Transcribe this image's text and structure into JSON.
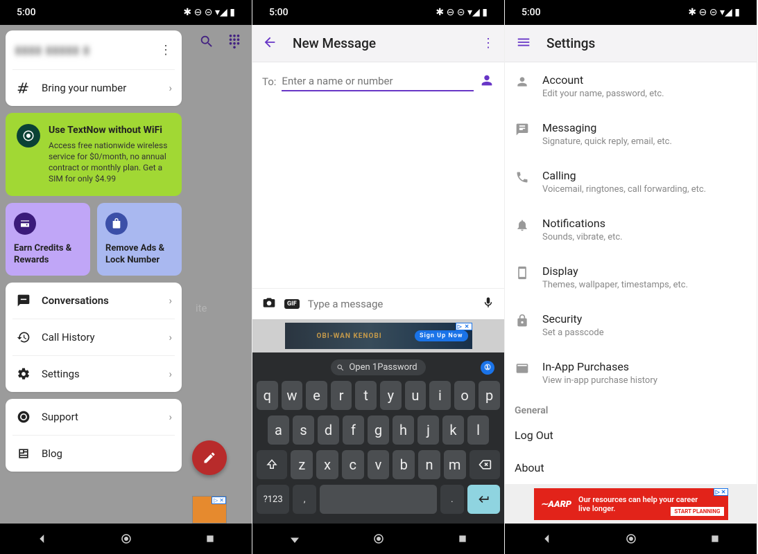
{
  "status": {
    "time": "5:00",
    "icons": "✱ ⊖ ⊝ ▾◢ ▮"
  },
  "s1": {
    "profile_blur": "▮▮▮▮ ▮▮▮▮▮ ▮",
    "bring": "Bring your number",
    "promo_title": "Use TextNow without WiFi",
    "promo_body": "Access free nationwide wireless service for $0/month, no annual contract or monthly plan. Get a SIM for only $4.99",
    "chip1": "Earn Credits & Rewards",
    "chip2": "Remove Ads & Lock Number",
    "menu": {
      "conversations": "Conversations",
      "call_history": "Call History",
      "settings": "Settings",
      "support": "Support",
      "blog": "Blog"
    },
    "dimmed": "ite",
    "ad_label": "▷ ✕"
  },
  "s2": {
    "title": "New Message",
    "to_label": "To:",
    "to_placeholder": "Enter a name or number",
    "msg_placeholder": "Type a message",
    "gif": "GIF",
    "ad_text": "OBI-WAN KENOBI",
    "ad_cta": "Sign Up Now",
    "ad_label": "▷ ✕",
    "kb_suggestion": "Open 1Password",
    "kb": {
      "r1": [
        "q",
        "w",
        "e",
        "r",
        "t",
        "y",
        "u",
        "i",
        "o",
        "p"
      ],
      "r2": [
        "a",
        "s",
        "d",
        "f",
        "g",
        "h",
        "j",
        "k",
        "l"
      ],
      "r3": [
        "z",
        "x",
        "c",
        "v",
        "b",
        "n",
        "m"
      ],
      "sym": "?123",
      "comma": ",",
      "period": "."
    }
  },
  "s3": {
    "title": "Settings",
    "items": [
      {
        "t": "Account",
        "s": "Edit your name, password, etc."
      },
      {
        "t": "Messaging",
        "s": "Signature, quick reply, email, etc."
      },
      {
        "t": "Calling",
        "s": "Voicemail, ringtones, call forwarding, etc."
      },
      {
        "t": "Notifications",
        "s": "Sounds, vibrate, etc."
      },
      {
        "t": "Display",
        "s": "Themes, wallpaper, timestamps, etc."
      },
      {
        "t": "Security",
        "s": "Set a passcode"
      },
      {
        "t": "In-App Purchases",
        "s": "View in-app purchase history"
      }
    ],
    "section": "General",
    "logout": "Log Out",
    "about": "About",
    "ad_logo": "∼AARP",
    "ad_text": "Our resources can help your career live longer.",
    "ad_cta": "START PLANNING",
    "ad_label": "▷ ✕"
  }
}
